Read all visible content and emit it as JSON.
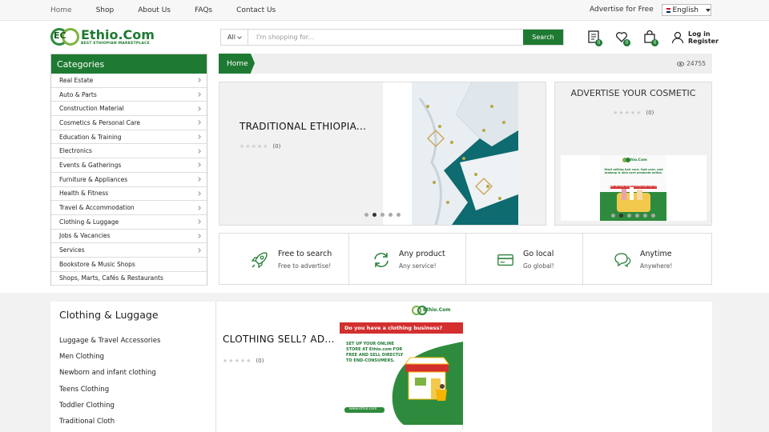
{
  "topbar": {
    "nav": [
      "Home",
      "Shop",
      "About Us",
      "FAQs",
      "Contact Us"
    ],
    "advertise": "Advertise for Free",
    "language": "English"
  },
  "logo": {
    "mark": "EC",
    "name": "Ethio.Com",
    "tagline": "BEST ETHIOPIAN MARKETPLACE"
  },
  "search": {
    "category": "All",
    "placeholder": "I'm shopping for...",
    "button": "Search"
  },
  "header_icons": {
    "compare_count": "0",
    "wishlist_count": "0",
    "cart_count": "0"
  },
  "account": {
    "login": "Log in",
    "register": "Register"
  },
  "categories": {
    "title": "Categories",
    "items": [
      {
        "label": "Real Estate",
        "arrow": true
      },
      {
        "label": "Auto & Parts",
        "arrow": true
      },
      {
        "label": "Construction Material",
        "arrow": true
      },
      {
        "label": "Cosmetics & Personal Care",
        "arrow": true
      },
      {
        "label": "Education & Training",
        "arrow": true
      },
      {
        "label": "Electronics",
        "arrow": true
      },
      {
        "label": "Events & Gatherings",
        "arrow": true
      },
      {
        "label": "Furniture & Appliances",
        "arrow": true
      },
      {
        "label": "Health & Fitness",
        "arrow": true
      },
      {
        "label": "Travel & Accommodation",
        "arrow": true
      },
      {
        "label": "Clothing & Luggage",
        "arrow": true
      },
      {
        "label": "Jobs & Vacancies",
        "arrow": true
      },
      {
        "label": "Services",
        "arrow": true
      },
      {
        "label": "Bookstore & Music Shops",
        "arrow": false
      },
      {
        "label": "Shops, Marts, Cafés & Restaurants",
        "arrow": false
      }
    ]
  },
  "breadcrumb": {
    "home": "Home",
    "views": "24755"
  },
  "slider_main": {
    "title": "TRADITIONAL ETHIOPIA...",
    "rating_count": "(0)",
    "active_dot": 1,
    "dot_count": 5
  },
  "slider_side": {
    "title": "ADVERTISE YOUR COSMETIC",
    "rating_count": "(0)",
    "active_dot": 1,
    "dot_count": 6,
    "ad": {
      "brand": "Ethio.Com",
      "text1": "Start selling hair care, foot care, and makeup & skin care products online.",
      "text2": "SET UP YOUR STORE AT ETHIO.COM FOR FREE"
    }
  },
  "features": [
    {
      "title": "Free to search",
      "subtitle": "Free to advertise!",
      "icon": "rocket-icon"
    },
    {
      "title": "Any product",
      "subtitle": "Any service!",
      "icon": "refresh-icon"
    },
    {
      "title": "Go local",
      "subtitle": "Go global!",
      "icon": "card-icon"
    },
    {
      "title": "Anytime",
      "subtitle": "Anywhere!",
      "icon": "chat-icon"
    }
  ],
  "clothing": {
    "title": "Clothing & Luggage",
    "items": [
      "Luggage & Travel Accessories",
      "Men Clothing",
      "Newborn and infant clothing",
      "Teens Clothing",
      "Toddler Clothing",
      "Traditional Cloth"
    ]
  },
  "product": {
    "title": "CLOTHING SELL? AD...",
    "rating_count": "(0)",
    "ad": {
      "brand": "Ethio.Com",
      "headline": "Do you have a clothing business?",
      "body": "SET UP YOUR ONLINE STORE AT Ethio.com FOR FREE AND SELL DIRECTLY TO END-CONSUMERS.",
      "url": "www.ethio.com"
    }
  },
  "colors": {
    "brand_green": "#1e7a32",
    "ad_red": "#d32f2f"
  }
}
